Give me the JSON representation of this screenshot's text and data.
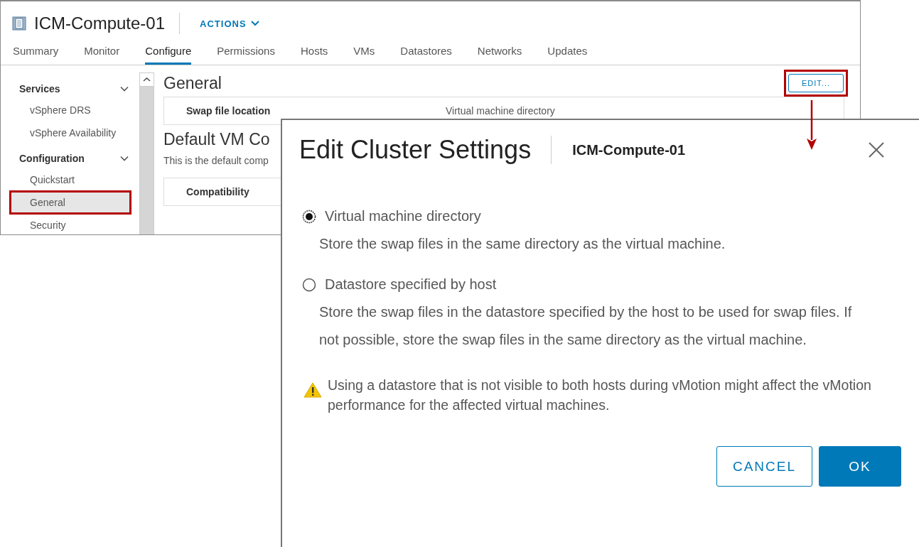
{
  "window": {
    "title": "ICM-Compute-01",
    "actions_label": "ACTIONS"
  },
  "tabs": [
    {
      "label": "Summary",
      "selected": false
    },
    {
      "label": "Monitor",
      "selected": false
    },
    {
      "label": "Configure",
      "selected": true
    },
    {
      "label": "Permissions",
      "selected": false
    },
    {
      "label": "Hosts",
      "selected": false
    },
    {
      "label": "VMs",
      "selected": false
    },
    {
      "label": "Datastores",
      "selected": false
    },
    {
      "label": "Networks",
      "selected": false
    },
    {
      "label": "Updates",
      "selected": false
    }
  ],
  "sidebar": {
    "groups": [
      {
        "label": "Services",
        "expanded": true,
        "items": [
          {
            "label": "vSphere DRS",
            "selected": false,
            "highlighted": false
          },
          {
            "label": "vSphere Availability",
            "selected": false,
            "highlighted": false
          }
        ]
      },
      {
        "label": "Configuration",
        "expanded": true,
        "items": [
          {
            "label": "Quickstart",
            "selected": false,
            "highlighted": false
          },
          {
            "label": "General",
            "selected": true,
            "highlighted": true
          },
          {
            "label": "Security",
            "selected": false,
            "highlighted": false
          }
        ]
      }
    ]
  },
  "content": {
    "heading": "General",
    "edit_button": {
      "label": "EDIT...",
      "highlighted": true
    },
    "swap_row": {
      "label": "Swap file location",
      "value": "Virtual machine directory"
    },
    "section_heading": "Default VM Co",
    "section_text": "This is the default comp",
    "compat_row": {
      "label": "Compatibility"
    }
  },
  "dialog": {
    "title": "Edit Cluster Settings",
    "subtitle": "ICM-Compute-01",
    "options": [
      {
        "label": "Virtual machine directory",
        "selected": true,
        "description": "Store the swap files in the same directory as the virtual machine."
      },
      {
        "label": "Datastore specified by host",
        "selected": false,
        "description": "Store the swap files in the datastore specified by the host to be used for swap files. If not possible, store the swap files in the same directory as the virtual machine."
      }
    ],
    "warning": "Using a datastore that is not visible to both hosts during vMotion might affect the vMotion performance for the affected virtual machines.",
    "buttons": [
      {
        "label": "CANCEL",
        "kind": "secondary"
      },
      {
        "label": "OK",
        "kind": "primary"
      }
    ]
  }
}
